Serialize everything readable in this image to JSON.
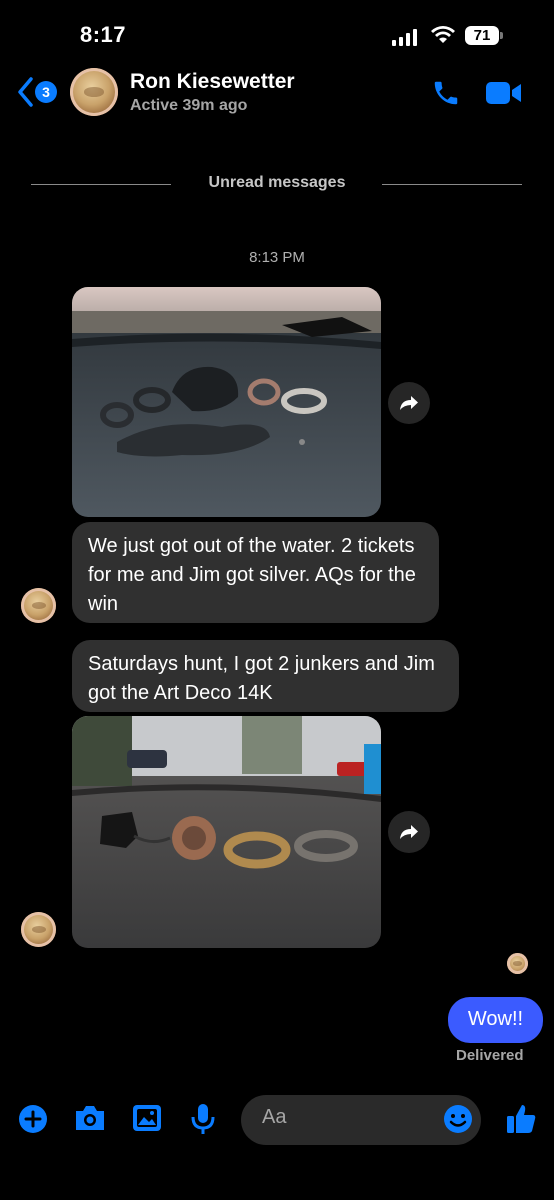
{
  "status_bar": {
    "time": "8:17",
    "battery": "71"
  },
  "header": {
    "back_count": "3",
    "contact_name": "Ron Kiesewetter",
    "contact_status": "Active 39m ago"
  },
  "thread": {
    "unread_label": "Unread messages",
    "timestamp": "8:13 PM",
    "messages": [
      {
        "type": "photo",
        "description_icon": "photo-rocks-rings"
      },
      {
        "type": "text",
        "text": "We just got out of the water. 2 tickets for me and Jim got silver. AQs for the win"
      },
      {
        "type": "text",
        "text": "Saturdays hunt, I got 2 junkers and Jim got the Art Deco 14K"
      },
      {
        "type": "photo",
        "description_icon": "photo-rings-dashboard"
      }
    ],
    "sent_message": "Wow!!",
    "delivery_status": "Delivered"
  },
  "composer": {
    "placeholder": "Aa"
  },
  "colors": {
    "accent": "#0a7cff",
    "sent_bubble": "#3b5bff",
    "received_bubble": "#303030"
  }
}
